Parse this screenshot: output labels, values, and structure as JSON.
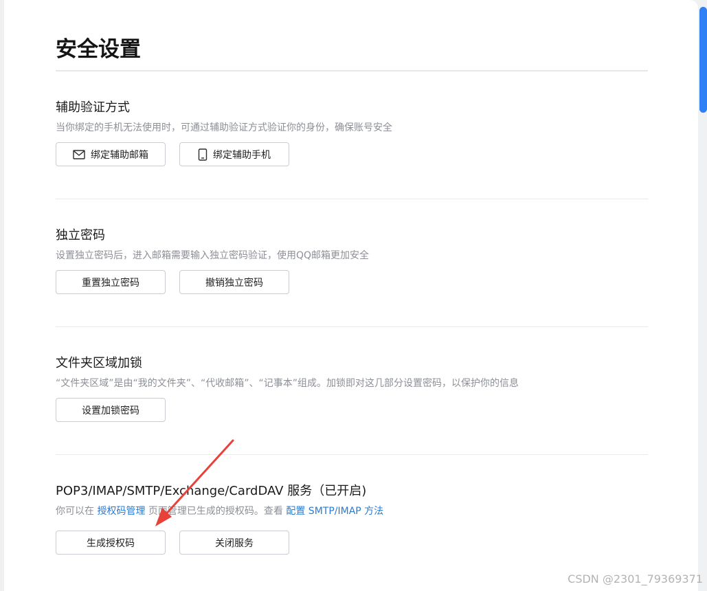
{
  "page": {
    "title": "安全设置"
  },
  "sections": [
    {
      "title": "辅助验证方式",
      "description": "当你绑定的手机无法使用时，可通过辅助验证方式验证你的身份，确保账号安全",
      "buttons": [
        {
          "label": "绑定辅助邮箱",
          "icon": "mail-icon"
        },
        {
          "label": "绑定辅助手机",
          "icon": "phone-icon"
        }
      ]
    },
    {
      "title": "独立密码",
      "description": "设置独立密码后，进入邮箱需要输入独立密码验证，使用QQ邮箱更加安全",
      "buttons": [
        {
          "label": "重置独立密码"
        },
        {
          "label": "撤销独立密码"
        }
      ]
    },
    {
      "title": "文件夹区域加锁",
      "description": "“文件夹区域”是由“我的文件夹”、“代收邮箱”、“记事本”组成。加锁即对这几部分设置密码，以保护你的信息",
      "buttons": [
        {
          "label": "设置加锁密码"
        }
      ]
    },
    {
      "title": "POP3/IMAP/SMTP/Exchange/CardDAV 服务（已开启)",
      "description_parts": {
        "prefix": "你可以在 ",
        "link1": "授权码管理",
        "middle": " 页面管理已生成的授权码。查看 ",
        "link2": "配置 SMTP/IMAP 方法"
      },
      "buttons": [
        {
          "label": "生成授权码"
        },
        {
          "label": "关闭服务"
        }
      ]
    }
  ],
  "annotation": {
    "arrow_color": "#e8413a"
  },
  "watermark": "CSDN @2301_79369371",
  "colors": {
    "accent": "#2f7ff5",
    "link": "#2a7ad3",
    "arrow": "#e8413a"
  }
}
